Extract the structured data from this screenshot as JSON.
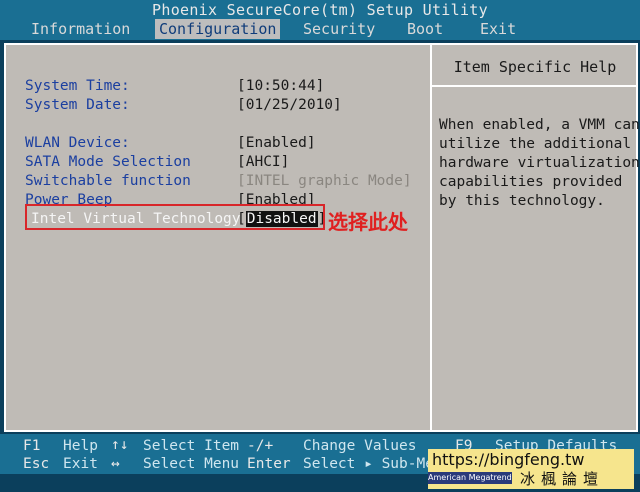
{
  "title": "Phoenix SecureCore(tm) Setup Utility",
  "menu": [
    {
      "label": "Information",
      "active": false
    },
    {
      "label": "Configuration",
      "active": true
    },
    {
      "label": "Security",
      "active": false
    },
    {
      "label": "Boot",
      "active": false
    },
    {
      "label": "Exit",
      "active": false
    }
  ],
  "settings": {
    "system_time": {
      "label": "System Time:",
      "value": "[10:50:44]"
    },
    "system_date": {
      "label": "System Date:",
      "value": "[01/25/2010]"
    },
    "wlan": {
      "label": "WLAN Device:",
      "value": "[Enabled]"
    },
    "sata": {
      "label": "SATA Mode Selection",
      "value": "[AHCI]"
    },
    "switchable": {
      "label": "Switchable function",
      "value": "[INTEL graphic Mode]"
    },
    "beep": {
      "label": "Power Beep",
      "value": "[Enabled]"
    },
    "vt": {
      "label": "Intel Virtual Technology",
      "open": "[",
      "value": "Disabled",
      "close": "]"
    }
  },
  "help": {
    "title": "Item Specific Help",
    "text": "When enabled, a VMM can\nutilize the additional\nhardware virtualization\ncapabilities provided\nby this technology."
  },
  "annotation": "选择此处",
  "footer": {
    "f1": "F1",
    "help": "Help",
    "updown": "↑↓",
    "select_item": "Select Item",
    "minusplus": "-/+",
    "change_values": "Change Values",
    "f9": "F9",
    "setup_defaults": "Setup Defaults",
    "esc": "Esc",
    "exit": "Exit",
    "leftright": "↔",
    "select_menu": "Select Menu",
    "enter": "Enter",
    "select_sub": "Select ▸ Sub-Menu"
  },
  "watermark": {
    "url": "https://bingfeng.tw",
    "name": "冰楓論壇",
    "strip": "American Megatrends"
  }
}
